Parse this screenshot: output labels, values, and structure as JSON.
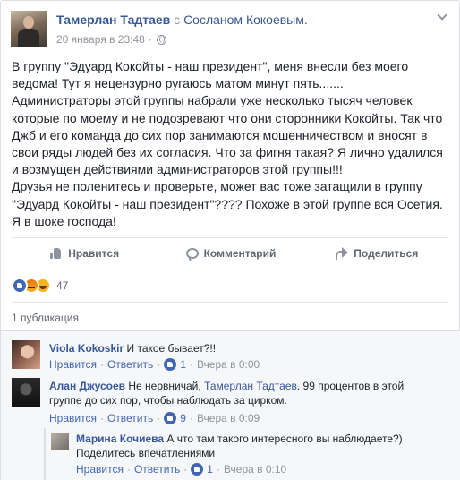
{
  "post": {
    "author": "Тамерлан Тадтаев",
    "with_word": "с",
    "tagged": "Сосланом Кокоевым.",
    "timestamp": "20 января в 23:48",
    "separator": "·",
    "privacy_icon": "globe-icon",
    "text": "В группу \"Эдуард Кокойты - наш президент\", меня внесли без моего ведома! Тут я нецензурно ругаюсь матом минут пять.......\nАдминистраторы этой группы набрали уже несколько тысяч человек которые по моему и не подозревают что они сторонники Кокойты. Так что Джб и его команда до сих пор занимаются мошенничеством и вносят в свои ряды людей без их согласия. Что за фигня такая? Я лично удалился и возмущен действиями администраторов этой группы!!!\nДрузья не поленитесь и проверьте, может вас тоже затащили в группу \"Эдуард Кокойты - наш президент\"???? Похоже в этой группе вся Осетия. Я в шоке господа!"
  },
  "actions": {
    "like": "Нравится",
    "comment": "Комментарий",
    "share": "Поделиться"
  },
  "reactions": {
    "count": "47"
  },
  "shares": {
    "label": "1 публикация"
  },
  "comments": [
    {
      "author": "Viola Kokoskir",
      "text": "И такое бывает?!!",
      "like": "Нравится",
      "reply": "Ответить",
      "likes": "1",
      "time": "Вчера в 0:00"
    },
    {
      "author": "Алан Джусоев",
      "text_before": "Не нервничай,",
      "tag": "Тамерлан Тадтаев",
      "text_after": ". 99 процентов в этой группе до сих пор, чтобы наблюдать за цирком.",
      "like": "Нравится",
      "reply": "Ответить",
      "likes": "9",
      "time": "Вчера в 0:09"
    },
    {
      "author": "Марина Кочиева",
      "text": "А что там такого интересного вы наблюдаете?) Поделитесь впечатлениями",
      "like": "Нравится",
      "reply": "Ответить",
      "likes": "1",
      "time": "Вчера в 0:10"
    }
  ],
  "colors": {
    "link": "#365899",
    "muted": "#90949c",
    "accent": "#4267b2"
  }
}
